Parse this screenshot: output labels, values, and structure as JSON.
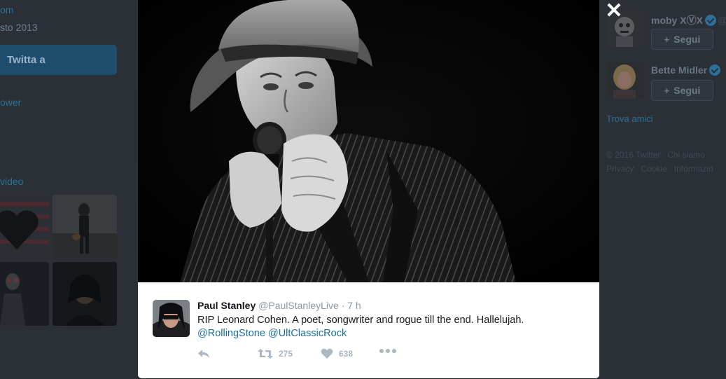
{
  "background_page": {
    "left_col": {
      "truncated_site": "om",
      "joined_date": "sto 2013",
      "tweet_to_label": "Twitta a",
      "follower_link": "ower",
      "media_title": "video"
    },
    "who_to_follow": [
      {
        "name": "moby XⓋX",
        "verified": true,
        "handle_fragment": "@",
        "follow_label": "Segui"
      },
      {
        "name": "Bette Midler",
        "verified": true,
        "handle_fragment": "",
        "follow_label": "Segui"
      }
    ],
    "find_friends": "Trova amici",
    "footer_line1": [
      "© 2016 Twitter",
      "Chi siamo"
    ],
    "footer_line2": [
      "Privacy",
      "Cookie",
      "Informazio"
    ]
  },
  "modal": {
    "close_glyph": "✕",
    "tweet": {
      "author_name": "Paul Stanley",
      "author_handle": "@PaulStanleyLive",
      "separator": "·",
      "time": "7 h",
      "text": "RIP Leonard Cohen. A poet, songwriter and rogue till the end. Hallelujah.",
      "mentions": [
        "@RollingStone",
        "@UltClassicRock"
      ],
      "retweet_count": "275",
      "like_count": "638"
    },
    "icons": {
      "reply": "reply-icon",
      "retweet": "retweet-icon",
      "like": "heart-icon",
      "more": "more-dots-icon",
      "close": "close-icon"
    }
  },
  "colors": {
    "overlay_bg": "#2a3036",
    "link": "#1b6e9e",
    "muted": "#8899a6"
  }
}
